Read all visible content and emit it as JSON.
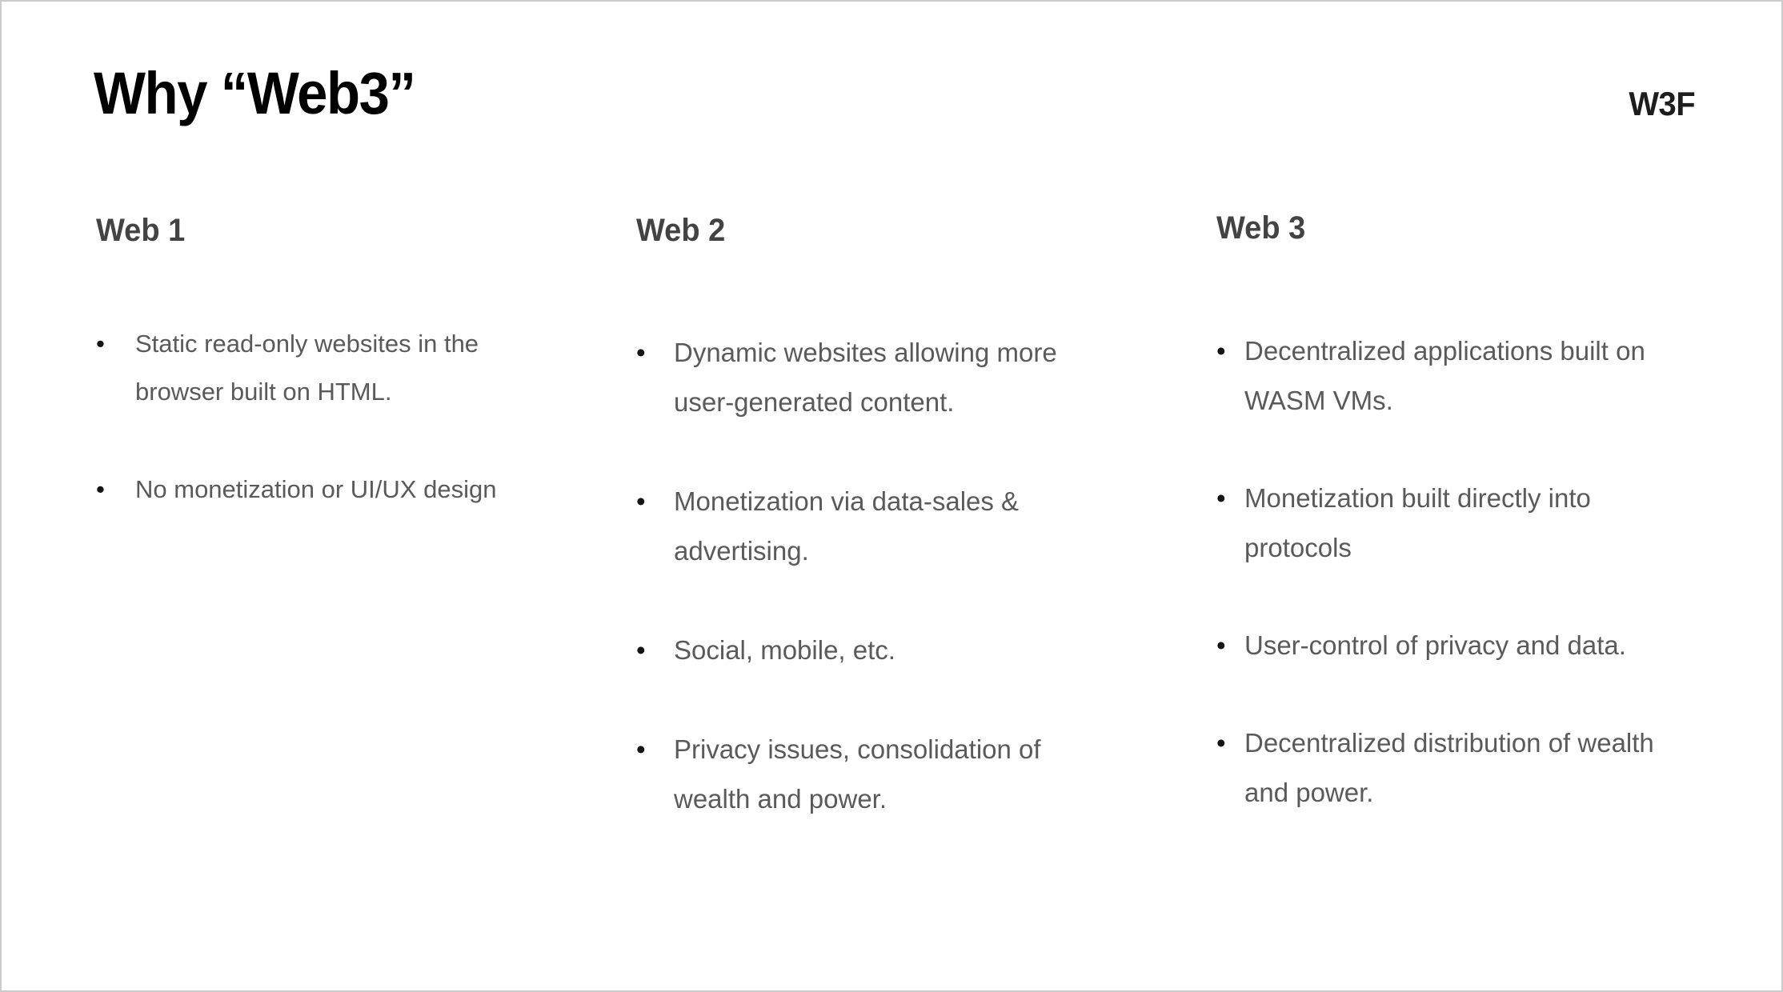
{
  "slide": {
    "title": "Why “Web3”",
    "brand": "W3F",
    "background_color": "#ffffff",
    "border_color": "#cccccc",
    "title_color": "#000000",
    "heading_color": "#434343",
    "body_color": "#5a5a5a",
    "bullet_color": "#141414"
  },
  "columns": [
    {
      "heading": "Web 1",
      "bullets": [
        "Static read-only websites in the browser built on HTML.",
        "No monetization or UI/UX design"
      ]
    },
    {
      "heading": "Web 2",
      "bullets": [
        "Dynamic websites allowing more user-generated content.",
        "Monetization via data-sales & advertising.",
        "Social, mobile, etc.",
        "Privacy issues, consolidation of wealth and power."
      ]
    },
    {
      "heading": "Web 3",
      "bullets": [
        "Decentralized applications built on WASM VMs.",
        "Monetization built directly into protocols",
        "User-control of privacy and data.",
        "Decentralized distribution of wealth and power."
      ]
    }
  ],
  "bullet_glyph": "•"
}
